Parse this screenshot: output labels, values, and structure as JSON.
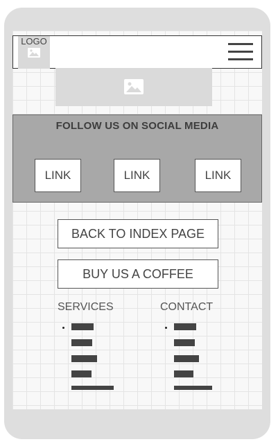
{
  "header": {
    "logo_label": "LOGO",
    "logo_icon": "image-icon",
    "menu_icon": "hamburger-menu-icon"
  },
  "hero": {
    "icon": "image-icon"
  },
  "social": {
    "title": "FOLLOW US ON SOCIAL MEDIA",
    "links": [
      "LINK",
      "LINK",
      "LINK"
    ]
  },
  "actions": {
    "back_label": "BACK TO INDEX PAGE",
    "coffee_label": "BUY US A COFFEE"
  },
  "footer": {
    "services_title": "SERVICES",
    "contact_title": "CONTACT"
  },
  "colors": {
    "panel": "#a8a8a8",
    "placeholder": "#dadada",
    "bars": "#444444"
  }
}
